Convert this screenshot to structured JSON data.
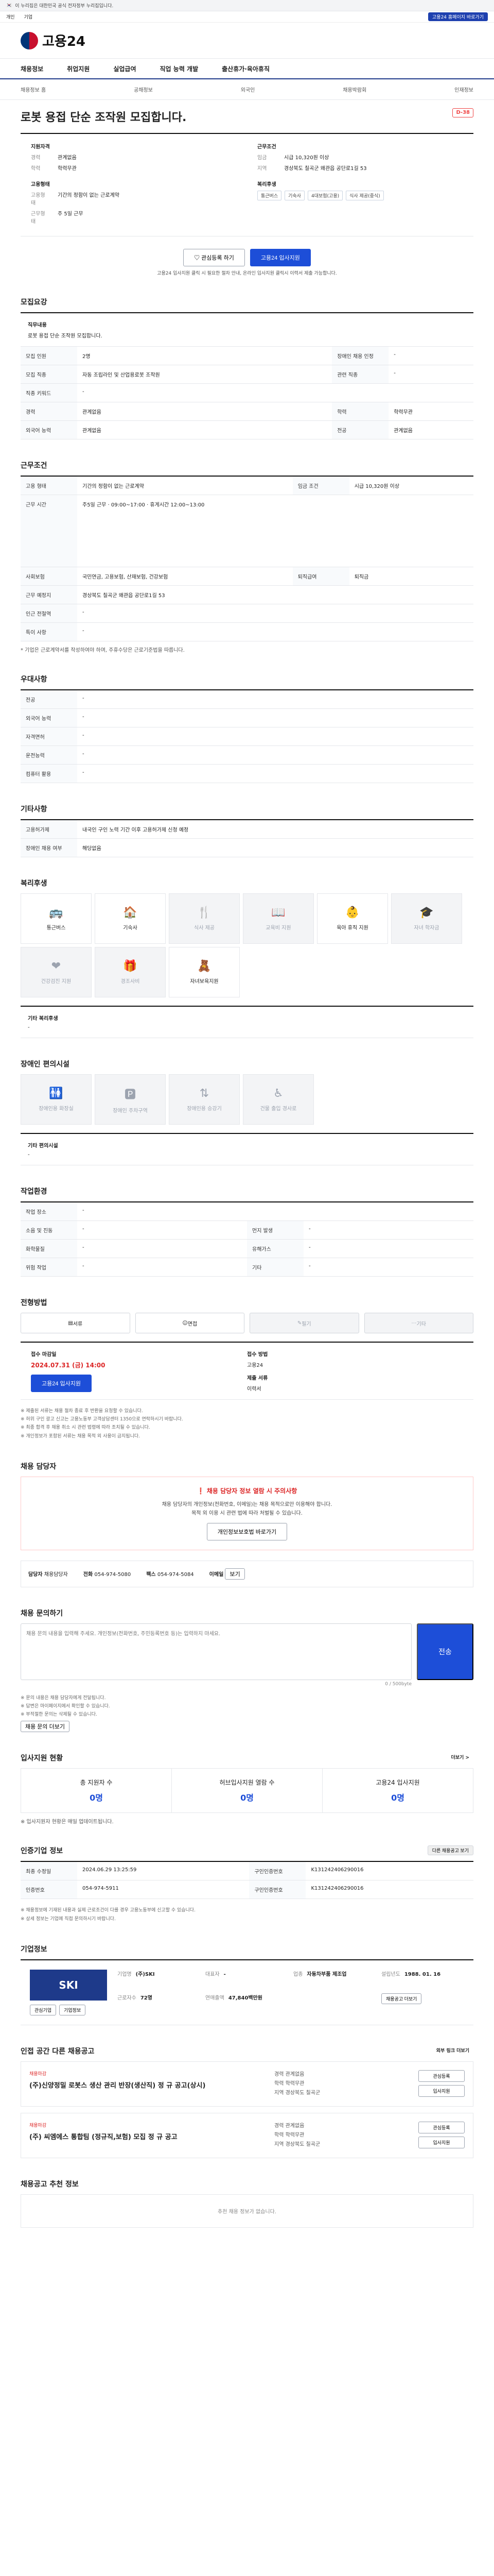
{
  "gov_banner": "이 누리집은 대한민국 공식 전자정부 누리집입니다.",
  "util": {
    "left": [
      "개인",
      "기업"
    ],
    "right": "고용24 홈페이지 바로가기"
  },
  "brand": {
    "name": "고용24"
  },
  "gnb": [
    "채용정보",
    "취업지원",
    "실업급여",
    "직업 능력 개발",
    "출산휴가·육아휴직"
  ],
  "subnav": [
    "채용정보 홈",
    "공채정보",
    "외국인",
    "채용박람회",
    "인재정보"
  ],
  "hero": {
    "title": "로봇 용접 단순 조작원 모집합니다.",
    "badge": "D-38",
    "left_head": "지원자격",
    "left_rows": [
      {
        "k": "경력",
        "v": "관계없음"
      },
      {
        "k": "학력",
        "v": "학력무관"
      }
    ],
    "right_head": "근무조건",
    "right_rows": [
      {
        "k": "임금",
        "v": "시급 10,320원 이상"
      },
      {
        "k": "지역",
        "v": "경상북도 칠곡군 왜관읍 공단로1길 53"
      }
    ],
    "form_head": "고용형태",
    "form_rows": [
      {
        "k": "고용형태",
        "v": "기간의 정함이 없는 근로계약"
      },
      {
        "k": "근무형태",
        "v": "주 5일 근무"
      }
    ],
    "welfare_head": "복리후생",
    "welfare_chips": [
      "통근버스",
      "기숙사",
      "4대보험(고용)",
      "식사 제공(중식)"
    ],
    "btn_fav": "관심등록 하기",
    "btn_apply": "고용24 입사지원",
    "note": "고용24 입사지원 클릭 시 필요한 절차 안내, 온라인 입사지원 클릭시 이력서 제출 가능합니다."
  },
  "recruit": {
    "title": "모집요강",
    "duty_head": "직무내용",
    "duty_text": "로봇 용접 단순 조작원 모집합니다.",
    "rows": [
      {
        "k1": "모집 인원",
        "v1": "2명",
        "k2": "장애인 채용 인정",
        "v2": "-"
      },
      {
        "k1": "모집 직종",
        "v1": "자동 조립라인 및 산업용로봇 조작원",
        "k2": "관련 직종",
        "v2": "-"
      },
      {
        "k1": "직종 키워드",
        "v1": "-",
        "k2": "",
        "v2": ""
      },
      {
        "k1": "경력",
        "v1": "관계없음",
        "k2": "학력",
        "v2": "학력무관"
      },
      {
        "k1": "외국어 능력",
        "v1": "관계없음",
        "k2": "전공",
        "v2": "관계없음"
      }
    ]
  },
  "work": {
    "title": "근무조건",
    "type": "기간의 정함이 없는 근로계약",
    "pay": "시급 10,320원 이상",
    "time": "주5일 근무 · 09:00~17:00 · 휴게시간 12:00~13:00",
    "insurance": "국민연금, 고용보험, 산재보험, 건강보험",
    "retire": "퇴직금",
    "addr": "경상북도 칠곡군 왜관읍 공단로1길 53",
    "remark": "-",
    "footnote": "* 기업은 근로계약서를 작성하여야 하며, 주휴수당은 근로기준법을 따릅니다."
  },
  "prefs": {
    "title": "우대사항",
    "rows": [
      "전공",
      "외국어 능력",
      "자격면허",
      "운전능력",
      "컴퓨터 활용"
    ]
  },
  "etc": {
    "title": "기타사항",
    "rows": [
      {
        "k": "고용허가제",
        "v": "내국인 구인 노력 기간 이후 고용허가제 신청 예정"
      },
      {
        "k": "장애인 채용 여부",
        "v": "해당없음"
      }
    ]
  },
  "benefits": {
    "title": "복리후생",
    "items": [
      {
        "label": "통근버스",
        "on": true,
        "sym": "🚌"
      },
      {
        "label": "기숙사",
        "on": true,
        "sym": "🏠"
      },
      {
        "label": "식사 제공",
        "on": false,
        "sym": "🍴"
      },
      {
        "label": "교육비 지원",
        "on": false,
        "sym": "📖"
      },
      {
        "label": "육아 휴직 지원",
        "on": true,
        "sym": "👶"
      },
      {
        "label": "자녀 학자금",
        "on": false,
        "sym": "🎓"
      },
      {
        "label": "건강검진 지원",
        "on": false,
        "sym": "❤"
      },
      {
        "label": "경조사비",
        "on": false,
        "sym": "🎁"
      },
      {
        "label": "자녀보육지원",
        "on": true,
        "sym": "🧸"
      }
    ],
    "other_label": "기타 복리후생",
    "other_value": "-"
  },
  "disab": {
    "title": "장애인 편의시설",
    "items": [
      "장애인용 화장실",
      "장애인 주차구역",
      "장애인용 승강기",
      "건물 출입 경사로"
    ],
    "other_label": "기타 편의시설",
    "other_value": "-"
  },
  "env": {
    "title": "작업환경",
    "rows": [
      {
        "k1": "작업 장소",
        "v1": "-",
        "k2": "",
        "v2": ""
      },
      {
        "k1": "소음 및 진동",
        "v1": "-",
        "k2": "먼지 발생",
        "v2": "-"
      },
      {
        "k1": "화학물질",
        "v1": "-",
        "k2": "유해가스",
        "v2": "-"
      },
      {
        "k1": "위험 작업",
        "v1": "-",
        "k2": "기타",
        "v2": "-"
      }
    ]
  },
  "screen": {
    "title": "전형방법",
    "methods": [
      {
        "label": "서류",
        "on": true
      },
      {
        "label": "면접",
        "on": true
      },
      {
        "label": "필기",
        "on": false
      },
      {
        "label": "기타",
        "on": false
      }
    ],
    "deadline_label": "접수 마감일",
    "deadline": "2024.07.31 (금) 14:00",
    "way_label": "접수 방법",
    "way": "고용24",
    "docs_label": "제출 서류",
    "docs": "이력서",
    "btn": "고용24 입사지원",
    "notes": [
      "※ 제출된 서류는 채용 절차 종료 후 반환을 요청할 수 있습니다.",
      "※ 허위 구인 광고 신고는 고용노동부 고객상담센터 1350으로 연락하시기 바랍니다.",
      "※ 최종 합격 후 채용 취소 시 관련 법령에 따라 조치될 수 있습니다.",
      "※ 개인정보가 포함된 서류는 채용 목적 외 사용이 금지됩니다."
    ]
  },
  "contact": {
    "title": "채용 담당자",
    "alert_title": "❗ 채용 담당자 정보 열람 시 주의사항",
    "alert_lines": [
      "채용 담당자의 개인정보(전화번호, 이메일)는 채용 목적으로만 이용해야 합니다.",
      "목적 외 이용 시 관련 법에 따라 처벌될 수 있습니다."
    ],
    "alert_btn": "개인정보보호법 바로가기",
    "name_label": "담당자",
    "name": "채용담당자",
    "tel_label": "전화",
    "tel": "054-974-5080",
    "fax_label": "팩스",
    "fax": "054-974-5084",
    "email_label": "이메일",
    "email_btn": "보기"
  },
  "qna": {
    "title": "채용 문의하기",
    "placeholder": "채용 문의 내용을 입력해 주세요. 개인정보(전화번호, 주민등록번호 등)는 입력하지 마세요.",
    "counter": "0 / 500byte",
    "btn": "전송",
    "notes": [
      "※ 문의 내용은 채용 담당자에게 전달됩니다.",
      "※ 답변은 마이페이지에서 확인할 수 있습니다.",
      "※ 부적절한 문의는 삭제될 수 있습니다."
    ],
    "more": "채용 문의 더보기"
  },
  "status": {
    "title": "입사지원 현황",
    "more": "더보기 >",
    "items": [
      {
        "label": "총 지원자 수",
        "value": "0명"
      },
      {
        "label": "허브입사지원 열람 수",
        "value": "0명"
      },
      {
        "label": "고용24 입사지원",
        "value": "0명"
      }
    ],
    "note": "※ 입사지원자 현황은 매일 업데이트됩니다."
  },
  "info": {
    "title": "인증기업 정보",
    "more_btn": "다른 채용공고 보기",
    "rows": [
      {
        "k1": "최종 수정일",
        "v1": "2024.06.29 13:25:59",
        "k2": "구인인증번호",
        "v2": "K131242406290016"
      },
      {
        "k1": "인증번호",
        "v1": "054-974-5911",
        "k2": "구인인증번호",
        "v2": "K131242406290016"
      }
    ],
    "notes": [
      "※ 채용정보에 기재된 내용과 실제 근로조건이 다를 경우 고용노동부에 신고할 수 있습니다.",
      "※ 상세 정보는 기업에 직접 문의하시기 바랍니다."
    ]
  },
  "company": {
    "title": "기업정보",
    "logo": "SKI",
    "btns": [
      "관심기업",
      "기업정보"
    ],
    "rows": [
      {
        "k": "기업명",
        "v": "(주)SKI"
      },
      {
        "k": "대표자",
        "v": "-"
      },
      {
        "k": "업종",
        "v": "자동차부품 제조업"
      },
      {
        "k": "설립년도",
        "v": "1988. 01. 16"
      },
      {
        "k": "근로자수",
        "v": "72명"
      },
      {
        "k": "연매출액",
        "v": "47,840백만원"
      }
    ],
    "btn": "채용공고 더보기"
  },
  "others": {
    "title": "인접 공간 다른 채용공고",
    "more": "외부 링크 더보기",
    "jobs": [
      {
        "co": "채용마감",
        "title": "(주)신양정밀 로봇스 생산 관리 반장(생산직) 정 규 공고(상시)",
        "lines": [
          "경력 관계없음",
          "학력 학력무관",
          "지역 경상북도 칠곡군"
        ],
        "btns": [
          "관심등록",
          "입사지원"
        ]
      },
      {
        "co": "채용마감",
        "title": "(주) 씨엠에스 통합팀 (정규직,보험) 모집 정 규 공고",
        "lines": [
          "경력 관계없음",
          "학력 학력무관",
          "지역 경상북도 칠곡군"
        ],
        "btns": [
          "관심등록",
          "입사지원"
        ]
      }
    ]
  },
  "recommend": {
    "title": "채용공고 추천 정보",
    "empty": "추천 채용 정보가 없습니다."
  }
}
